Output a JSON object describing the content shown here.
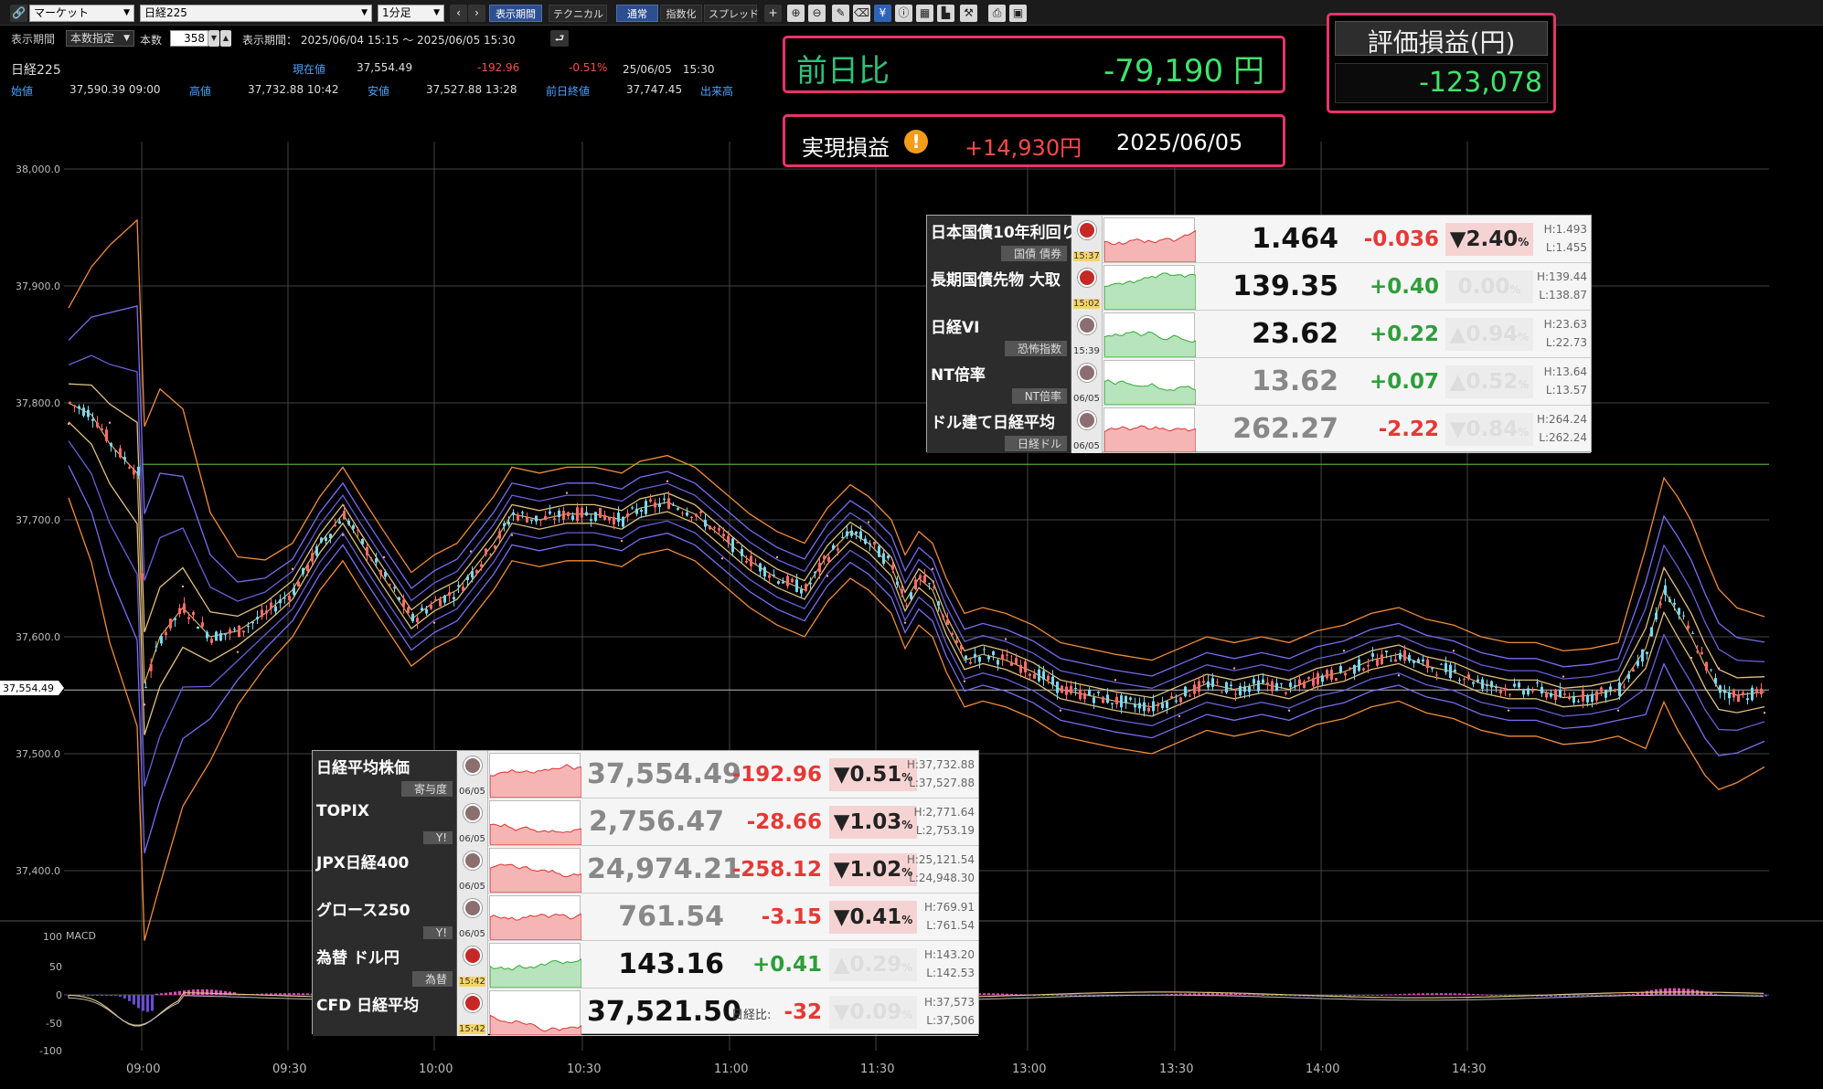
{
  "toolbar": {
    "market_select": "マーケット",
    "symbol_select": "日経225",
    "timeframe_select": "1分足",
    "period_btn": "表示期間",
    "technical_btn": "テクニカル",
    "normal_btn": "通常",
    "index_btn": "指数化",
    "spread_btn": "スプレッド"
  },
  "period_bar": {
    "period_label": "表示期間",
    "count_type": "本数指定",
    "count_label": "本数",
    "count_value": "358",
    "range_label": "表示期間：",
    "range_value": "2025/06/04 15:15 ～ 2025/06/05 15:30"
  },
  "quote": {
    "name": "日経225",
    "current_label": "現在値",
    "current": "37,554.49",
    "change": "-192.96",
    "change_pct": "-0.51%",
    "datetime": "25/06/05　15:30",
    "open_label": "始値",
    "open": "37,590.39  09:00",
    "high_label": "高値",
    "high": "37,732.88  10:42",
    "low_label": "安値",
    "low": "37,527.88  13:28",
    "prev_label": "前日終値",
    "prev": "37,747.45",
    "volume_label": "出来高"
  },
  "pnl": {
    "prev_day_label": "前日比",
    "prev_day_value": "-79,190 円",
    "unrealized_label": "評価損益(円)",
    "unrealized_value": "-123,078",
    "realized_label": "実現損益",
    "realized_value": "+14,930円",
    "realized_date": "2025/06/05"
  },
  "chart": {
    "y_ticks": [
      "38,000.0",
      "37,900.0",
      "37,800.0",
      "37,700.0",
      "37,600.0",
      "37,500.0",
      "37,400.0"
    ],
    "current_tag": "37,554.49",
    "x_ticks": [
      "09:00",
      "09:30",
      "10:00",
      "10:30",
      "11:00",
      "11:30",
      "13:00",
      "13:30",
      "14:00",
      "14:30"
    ],
    "macd_label": "MACD",
    "macd_ticks": [
      "100",
      "50",
      "0",
      "-50",
      "-100"
    ]
  },
  "top_table": [
    {
      "name": "日本国債10年利回り",
      "sub": "国債 債券",
      "time": "15:37",
      "live": true,
      "value": "1.464",
      "value_style": "blk",
      "change": "-0.036",
      "change_color": "#e53935",
      "pct": "▼2.40",
      "pct_style": "dn",
      "high": "H:1.493",
      "low": "L:1.455"
    },
    {
      "name": "長期国債先物 大取",
      "sub": "",
      "time": "15:02",
      "live": true,
      "value": "139.35",
      "value_style": "blk",
      "change": "+0.40",
      "change_color": "#2e9e3a",
      "pct": "0.00",
      "pct_style": "",
      "high": "H:139.44",
      "low": "L:138.87"
    },
    {
      "name": "日経VI",
      "sub": "恐怖指数",
      "time": "15:39",
      "live": false,
      "value": "23.62",
      "value_style": "blk",
      "change": "+0.22",
      "change_color": "#2e9e3a",
      "pct": "▲0.94",
      "pct_style": "",
      "high": "H:23.63",
      "low": "L:22.73"
    },
    {
      "name": "NT倍率",
      "sub": "NT倍率",
      "time": "06/05",
      "live": false,
      "value": "13.62",
      "value_style": "dim",
      "change": "+0.07",
      "change_color": "#2e9e3a",
      "pct": "▲0.52",
      "pct_style": "",
      "high": "H:13.64",
      "low": "L:13.57"
    },
    {
      "name": "ドル建て日経平均",
      "sub": "日経ドル",
      "time": "06/05",
      "live": false,
      "value": "262.27",
      "value_style": "dim",
      "change": "-2.22",
      "change_color": "#e53935",
      "pct": "▼0.84",
      "pct_style": "",
      "high": "H:264.24",
      "low": "L:262.24"
    }
  ],
  "bottom_table": [
    {
      "name": "日経平均株価",
      "sub": "寄与度",
      "time": "06/05",
      "live": false,
      "value": "37,554.49",
      "value_style": "dim",
      "change": "-192.96",
      "change_color": "#e53935",
      "pct": "▼0.51",
      "pct_style": "dn",
      "high": "H:37,732.88",
      "low": "L:37,527.88"
    },
    {
      "name": "TOPIX",
      "sub": "Y!",
      "time": "06/05",
      "live": false,
      "value": "2,756.47",
      "value_style": "dim",
      "change": "-28.66",
      "change_color": "#e53935",
      "pct": "▼1.03",
      "pct_style": "dn",
      "high": "H:2,771.64",
      "low": "L:2,753.19"
    },
    {
      "name": "JPX日経400",
      "sub": "",
      "time": "06/05",
      "live": false,
      "value": "24,974.21",
      "value_style": "dim",
      "change": "-258.12",
      "change_color": "#e53935",
      "pct": "▼1.02",
      "pct_style": "dn",
      "high": "H:25,121.54",
      "low": "L:24,948.30"
    },
    {
      "name": "グロース250",
      "sub": "Y!",
      "time": "06/05",
      "live": false,
      "value": "761.54",
      "value_style": "dim",
      "change": "-3.15",
      "change_color": "#e53935",
      "pct": "▼0.41",
      "pct_style": "dn",
      "high": "H:769.91",
      "low": "L:761.54"
    },
    {
      "name": "為替 ドル円",
      "sub": "為替",
      "time": "15:42",
      "live": true,
      "value": "143.16",
      "value_style": "blk",
      "change": "+0.41",
      "change_color": "#2e9e3a",
      "pct": "▲0.29",
      "pct_style": "",
      "high": "H:143.20",
      "low": "L:142.53"
    },
    {
      "name": "CFD 日経平均",
      "sub": "",
      "time": "15:42",
      "live": true,
      "value": "37,521.50",
      "value_style": "blk",
      "change": "-32",
      "change_color": "#e53935",
      "pct": "▼0.09",
      "pct_style": "",
      "high": "H:37,573",
      "low": "L:37,506",
      "note": "日経比:"
    }
  ]
}
